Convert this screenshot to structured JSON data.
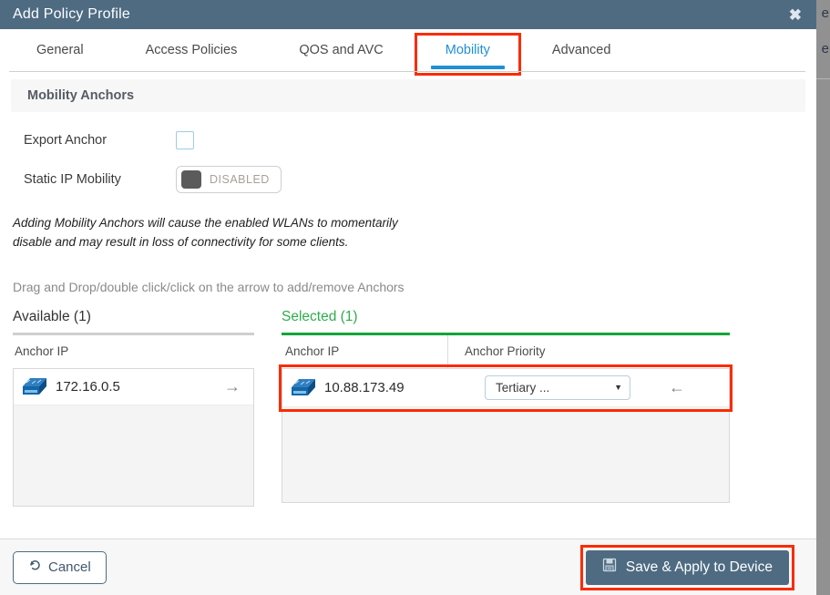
{
  "background": {
    "letter_1": "e",
    "letter_2": "e"
  },
  "modal": {
    "title": "Add Policy Profile",
    "close_label": "✖",
    "titlebar_color": "#4e6b82"
  },
  "tabs": [
    {
      "label": "General",
      "active": false
    },
    {
      "label": "Access Policies",
      "active": false
    },
    {
      "label": "QOS and AVC",
      "active": false
    },
    {
      "label": "Mobility",
      "active": true
    },
    {
      "label": "Advanced",
      "active": false
    }
  ],
  "section": {
    "header_title": "Mobility Anchors"
  },
  "form": {
    "export_anchor": {
      "label": "Export Anchor",
      "checked": false
    },
    "static_ip_mobility": {
      "label": "Static IP Mobility",
      "state": "DISABLED"
    }
  },
  "warning_text": "Adding Mobility Anchors will cause the enabled WLANs to momentarily disable and may result in loss of connectivity for some clients.",
  "hint_text": "Drag and Drop/double click/click on the arrow to add/remove Anchors",
  "available_panel": {
    "title": "Available (1)",
    "column_header": "Anchor IP",
    "rows": [
      {
        "ip": "172.16.0.5",
        "arrow": "→"
      }
    ]
  },
  "selected_panel": {
    "title": "Selected (1)",
    "column_headers": [
      "Anchor IP",
      "Anchor Priority"
    ],
    "rows": [
      {
        "ip": "10.88.173.49",
        "priority": "Tertiary ...",
        "caret": "▼",
        "arrow": "←"
      }
    ]
  },
  "footer": {
    "cancel_label": "Cancel",
    "save_label": "Save & Apply to Device"
  },
  "colors": {
    "accent_blue": "#1f8fd6",
    "green": "#13a538",
    "annotation_red": "#f92c02",
    "header_slate": "#4e6b82"
  }
}
